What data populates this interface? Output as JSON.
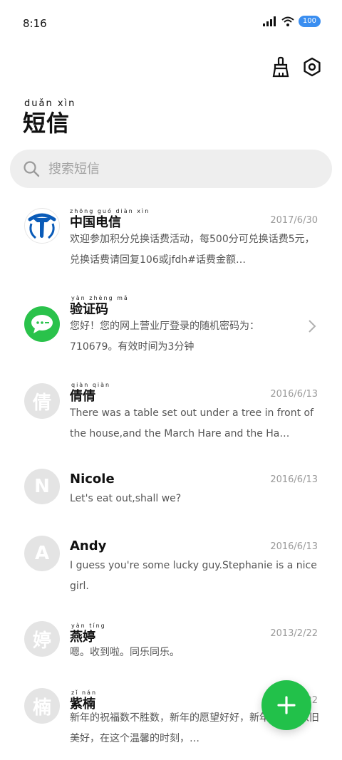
{
  "status_bar": {
    "time": "8:16",
    "battery": "100"
  },
  "page": {
    "title": "短信",
    "title_pinyin": "duǎn xìn"
  },
  "search": {
    "placeholder": "搜索短信"
  },
  "messages": [
    {
      "sender": "中国电信",
      "sender_pinyin": "zhōng guó diàn xìn",
      "date": "2017/6/30",
      "preview": "欢迎参加积分兑换话费活动，每500分可兑换话费5元，兑换话费请回复106或jfdh#话费金额…",
      "avatar": "telecom-logo"
    },
    {
      "sender": "验证码",
      "sender_pinyin": "yàn zhèng mǎ",
      "date": "",
      "preview": "您好！您的网上营业厅登录的随机密码为：710679。有效时间为3分钟",
      "avatar": "chat-bubble-icon"
    },
    {
      "sender": "倩倩",
      "sender_pinyin": "qiàn qiàn",
      "date": "2016/6/13",
      "preview": "There was a table set out under a tree in front of the house,and the March Hare and the Ha…",
      "avatar_text": "倩"
    },
    {
      "sender": "Nicole",
      "sender_pinyin": "",
      "date": "2016/6/13",
      "preview": "Let's eat out,shall we?",
      "avatar_text": "N"
    },
    {
      "sender": "Andy",
      "sender_pinyin": "",
      "date": "2016/6/13",
      "preview": "I guess you're some lucky guy.Stephanie is a nice girl.",
      "avatar_text": "A"
    },
    {
      "sender": "燕婷",
      "sender_pinyin": "yàn tíng",
      "date": "2013/2/22",
      "preview": "嗯。收到啦。同乐同乐。",
      "avatar_text": "婷"
    },
    {
      "sender": "紫楠",
      "sender_pinyin": "zǐ nán",
      "date": "2013/2/22",
      "preview": "新年的祝福数不胜数，新年的愿望好好，新年的问候依旧美好，在这个温馨的时刻，…",
      "avatar_text": "楠"
    }
  ],
  "colors": {
    "accent": "#22c14a",
    "telecom_blue": "#0a5bb8",
    "battery": "#3a8ef0"
  }
}
